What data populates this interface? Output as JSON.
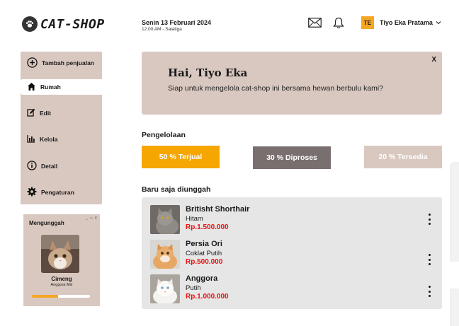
{
  "header": {
    "brand": "CAT-SHOP",
    "date": "Senin 13 Februari 2024",
    "time_location": "12.00 AM - Salatiga",
    "user_initials": "TE",
    "user_name": "Tiyo Eka Pratama",
    "icons": [
      "paw-icon",
      "mail-icon",
      "bell-icon",
      "chevron-down-icon"
    ]
  },
  "sidebar": {
    "items": [
      {
        "label": "Tambah penjualan",
        "icon": "plus-circle-icon"
      },
      {
        "label": "Rumah",
        "icon": "home-icon",
        "active": true
      },
      {
        "label": "Edit",
        "icon": "edit-icon"
      },
      {
        "label": "Kelola",
        "icon": "bar-chart-icon"
      },
      {
        "label": "Detail",
        "icon": "info-icon"
      },
      {
        "label": "Pengaturan",
        "icon": "gear-icon"
      }
    ]
  },
  "upload": {
    "title": "Mengunggah",
    "controls": "_ □ X",
    "name": "Cimeng",
    "breed": "Anggora Mix",
    "progress": 0.45
  },
  "banner": {
    "title": "Hai, Tiyo Eka",
    "subtitle": "Siap untuk mengelola cat-shop ini bersama hewan berbulu kami?",
    "close": "X"
  },
  "stats": {
    "title": "Pengelolaan",
    "items": [
      {
        "label": "50 % Terjual",
        "color": "#f5a600"
      },
      {
        "label": "30 % Diproses",
        "color": "#7a6f6f"
      },
      {
        "label": "20 % Tersedia",
        "color": "#d9c8c0"
      }
    ]
  },
  "recent": {
    "title": "Baru saja diunggah",
    "items": [
      {
        "name": "Britisht Shorthair",
        "color": "Hitam",
        "price": "Rp.1.500.000"
      },
      {
        "name": "Persia Ori",
        "color": "Coklat Putih",
        "price": "Rp.500.000"
      },
      {
        "name": "Anggora",
        "color": "Putih",
        "price": "Rp.1.000.000"
      }
    ]
  },
  "colors": {
    "accent": "#f5a623",
    "panel": "#d9c8c0",
    "price": "#e81010"
  }
}
